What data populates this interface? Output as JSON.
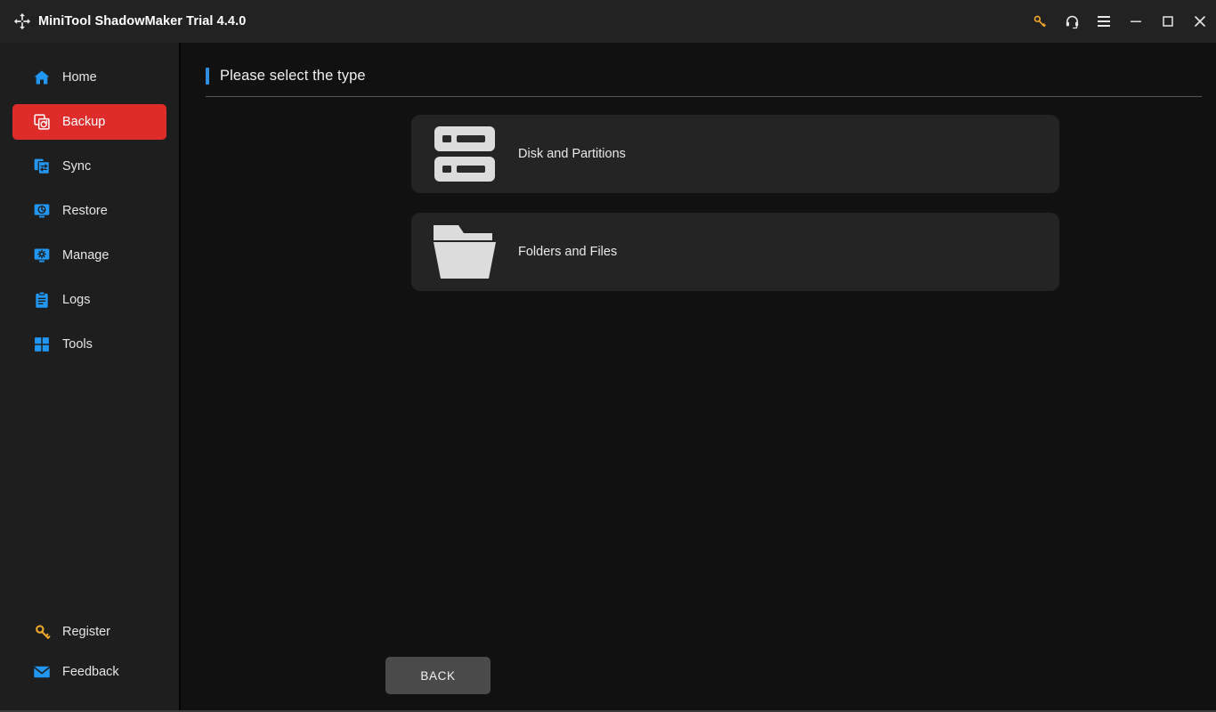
{
  "window": {
    "title": "MiniTool ShadowMaker Trial 4.4.0",
    "logo_icon": "shadowmaker-logo-icon",
    "controls": [
      {
        "name": "register-key-icon",
        "label": "Register",
        "color": "#f0a92a"
      },
      {
        "name": "support-headset-icon",
        "label": "Support",
        "color": "#e8e8e8"
      },
      {
        "name": "menu-hamburger-icon",
        "label": "Menu",
        "color": "#e8e8e8"
      },
      {
        "name": "minimize-icon",
        "label": "Minimize",
        "color": "#e8e8e8"
      },
      {
        "name": "maximize-icon",
        "label": "Maximize",
        "color": "#e8e8e8"
      },
      {
        "name": "close-icon",
        "label": "Close",
        "color": "#e8e8e8"
      }
    ]
  },
  "sidebar": {
    "items": [
      {
        "label": "Home",
        "icon": "home-icon",
        "active": false
      },
      {
        "label": "Backup",
        "icon": "backup-icon",
        "active": true
      },
      {
        "label": "Sync",
        "icon": "sync-icon",
        "active": false
      },
      {
        "label": "Restore",
        "icon": "restore-icon",
        "active": false
      },
      {
        "label": "Manage",
        "icon": "manage-icon",
        "active": false
      },
      {
        "label": "Logs",
        "icon": "logs-icon",
        "active": false
      },
      {
        "label": "Tools",
        "icon": "tools-icon",
        "active": false
      }
    ],
    "bottom_items": [
      {
        "label": "Register",
        "icon": "key-icon"
      },
      {
        "label": "Feedback",
        "icon": "envelope-icon"
      }
    ],
    "active_color": "#e02b2b",
    "icon_color": "#2196f3"
  },
  "main": {
    "page_title": "Please select the type",
    "accent_color": "#2f8fe0",
    "cards": [
      {
        "label": "Disk and Partitions",
        "icon": "disk-partitions-icon"
      },
      {
        "label": "Folders and Files",
        "icon": "folder-files-icon"
      }
    ],
    "back_label": "BACK"
  }
}
